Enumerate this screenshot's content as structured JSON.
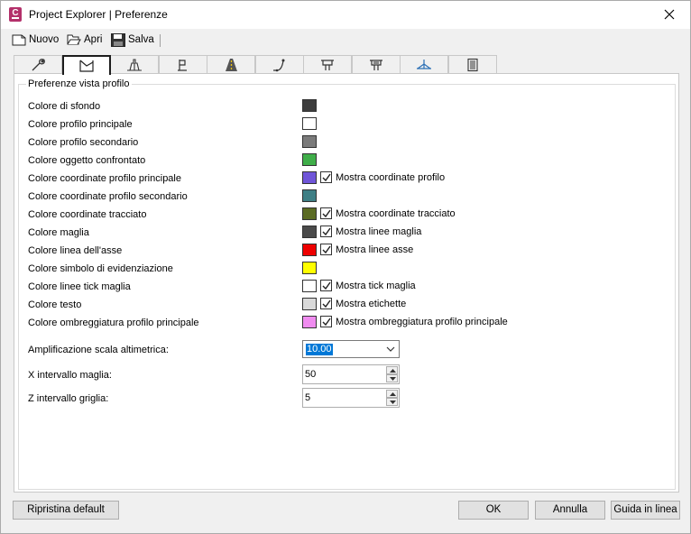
{
  "window": {
    "title": "Project Explorer | Preferenze"
  },
  "toolbar": {
    "new_label": "Nuovo",
    "open_label": "Apri",
    "save_label": "Salva"
  },
  "tabs": [
    {
      "icon": "wrench-icon"
    },
    {
      "icon": "profile-view-icon",
      "active": true
    },
    {
      "icon": "section-view-icon"
    },
    {
      "icon": "flag-icon"
    },
    {
      "icon": "road-icon"
    },
    {
      "icon": "alignment-curve-icon"
    },
    {
      "icon": "corridor-icon"
    },
    {
      "icon": "corridor-alt-icon"
    },
    {
      "icon": "cross-section-icon"
    },
    {
      "icon": "report-icon"
    }
  ],
  "group": {
    "title": "Preferenze vista profilo"
  },
  "rows": [
    {
      "label": "Colore di sfondo",
      "color": "#3d3d3d"
    },
    {
      "label": "Colore profilo principale",
      "color": "#ffffff"
    },
    {
      "label": "Colore profilo secondario",
      "color": "#7b7b7b"
    },
    {
      "label": "Colore oggetto confrontato",
      "color": "#3fae49"
    },
    {
      "label": "Colore coordinate profilo principale",
      "color": "#6f55d8",
      "checkbox": "Mostra coordinate profilo",
      "checked": true
    },
    {
      "label": "Colore coordinate profilo secondario",
      "color": "#3e7f85"
    },
    {
      "label": "Colore coordinate tracciato",
      "color": "#5b6b24",
      "checkbox": "Mostra coordinate tracciato",
      "checked": true
    },
    {
      "label": "Colore maglia",
      "color": "#4a4a4a",
      "checkbox": "Mostra linee maglia",
      "checked": true
    },
    {
      "label": "Colore linea dell'asse",
      "color": "#ee0000",
      "checkbox": "Mostra linee asse",
      "checked": true
    },
    {
      "label": "Colore simbolo di evidenziazione",
      "color": "#ffff00"
    },
    {
      "label": "Colore linee tick maglia",
      "color": "#ffffff",
      "checkbox": "Mostra tick maglia",
      "checked": true
    },
    {
      "label": "Colore testo",
      "color": "#d9d9d9",
      "checkbox": "Mostra etichette",
      "checked": true
    },
    {
      "label": "Colore ombreggiatura profilo principale",
      "color": "#f08cf0",
      "checkbox": "Mostra ombreggiatura profilo principale",
      "checked": true
    }
  ],
  "fields": {
    "scale_label": "Amplificazione scala altimetrica:",
    "scale_value": "10.00",
    "x_label": "X intervallo maglia:",
    "x_value": "50",
    "z_label": "Z intervallo griglia:",
    "z_value": "5"
  },
  "buttons": {
    "reset": "Ripristina default",
    "ok": "OK",
    "cancel": "Annulla",
    "help": "Guida in linea"
  }
}
